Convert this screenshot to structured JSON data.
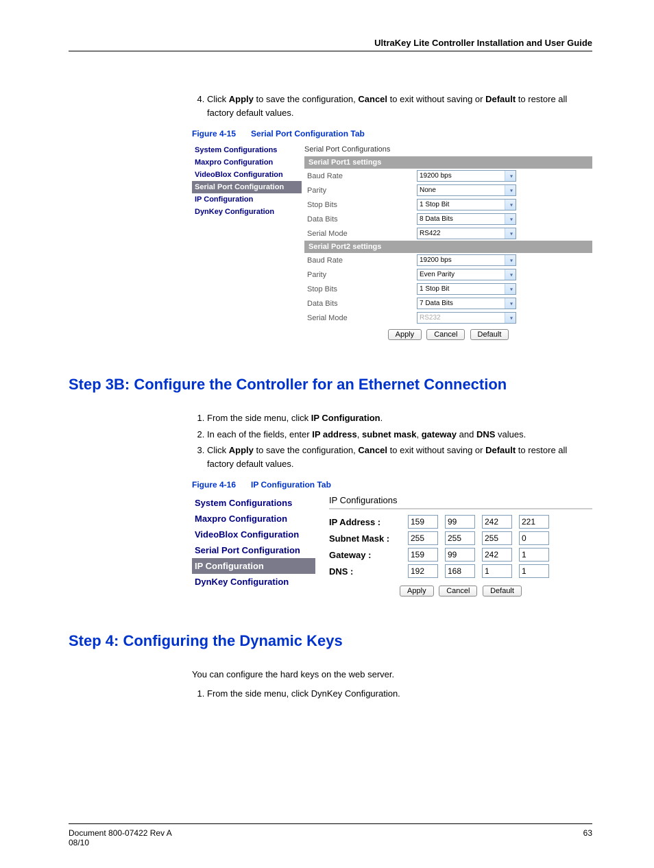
{
  "header": {
    "title": "UltraKey Lite Controller Installation and User Guide"
  },
  "intro_step": {
    "num": "4.",
    "prefix": "Click ",
    "apply": "Apply",
    "mid1": " to save the configuration, ",
    "cancel": "Cancel",
    "mid2": " to exit without saving or ",
    "default": "Default",
    "suffix": " to restore all factory default values."
  },
  "fig15": {
    "caption_num": "Figure 4-15",
    "caption_title": "Serial Port Configuration Tab",
    "side_items": [
      "System Configurations",
      "Maxpro Configuration",
      "VideoBlox Configuration",
      "Serial Port Configuration",
      "IP Configuration",
      "DynKey Configuration"
    ],
    "side_selected_index": 3,
    "title": "Serial Port Configurations",
    "section1": {
      "head": "Serial Port1 settings",
      "rows": [
        {
          "label": "Baud Rate",
          "value": "19200 bps"
        },
        {
          "label": "Parity",
          "value": "None"
        },
        {
          "label": "Stop Bits",
          "value": "1 Stop Bit"
        },
        {
          "label": "Data Bits",
          "value": "8 Data Bits"
        },
        {
          "label": "Serial Mode",
          "value": "RS422"
        }
      ]
    },
    "section2": {
      "head": "Serial Port2 settings",
      "rows": [
        {
          "label": "Baud Rate",
          "value": "19200 bps"
        },
        {
          "label": "Parity",
          "value": "Even Parity"
        },
        {
          "label": "Stop Bits",
          "value": "1 Stop Bit"
        },
        {
          "label": "Data Bits",
          "value": "7 Data Bits"
        },
        {
          "label": "Serial Mode",
          "value": "RS232",
          "disabled": true
        }
      ]
    },
    "buttons": {
      "apply": "Apply",
      "cancel": "Cancel",
      "default": "Default"
    }
  },
  "step3b": {
    "heading": "Step 3B: Configure the Controller for an Ethernet Connection",
    "li1": {
      "prefix": "From the side menu, click ",
      "bold": "IP Configuration",
      "suffix": "."
    },
    "li2": {
      "prefix": "In each of the fields, enter ",
      "b1": "IP address",
      "c1": ", ",
      "b2": "subnet mask",
      "c2": ", ",
      "b3": "gateway",
      "c3": " and ",
      "b4": "DNS",
      "suffix": " values."
    },
    "li3": {
      "prefix": "Click ",
      "apply": "Apply",
      "mid1": " to save the configuration, ",
      "cancel": "Cancel",
      "mid2": " to exit without saving or ",
      "default": "Default",
      "suffix": " to restore all factory default values."
    }
  },
  "fig16": {
    "caption_num": "Figure 4-16",
    "caption_title": "IP Configuration Tab",
    "side_items": [
      "System Configurations",
      "Maxpro Configuration",
      "VideoBlox Configuration",
      "Serial Port Configuration",
      "IP Configuration",
      "DynKey Configuration"
    ],
    "side_selected_index": 4,
    "title": "IP Configurations",
    "rows": [
      {
        "label": "IP Address :",
        "v": [
          "159",
          "99",
          "242",
          "221"
        ]
      },
      {
        "label": "Subnet Mask :",
        "v": [
          "255",
          "255",
          "255",
          "0"
        ]
      },
      {
        "label": "Gateway :",
        "v": [
          "159",
          "99",
          "242",
          "1"
        ]
      },
      {
        "label": "DNS :",
        "v": [
          "192",
          "168",
          "1",
          "1"
        ]
      }
    ],
    "buttons": {
      "apply": "Apply",
      "cancel": "Cancel",
      "default": "Default"
    }
  },
  "step4": {
    "heading": "Step 4: Configuring the Dynamic Keys",
    "para": "You can configure the hard keys on the web server.",
    "li1": "From the side menu, click DynKey Configuration."
  },
  "footer": {
    "doc": "Document 800-07422 Rev A",
    "date": "08/10",
    "page": "63"
  }
}
